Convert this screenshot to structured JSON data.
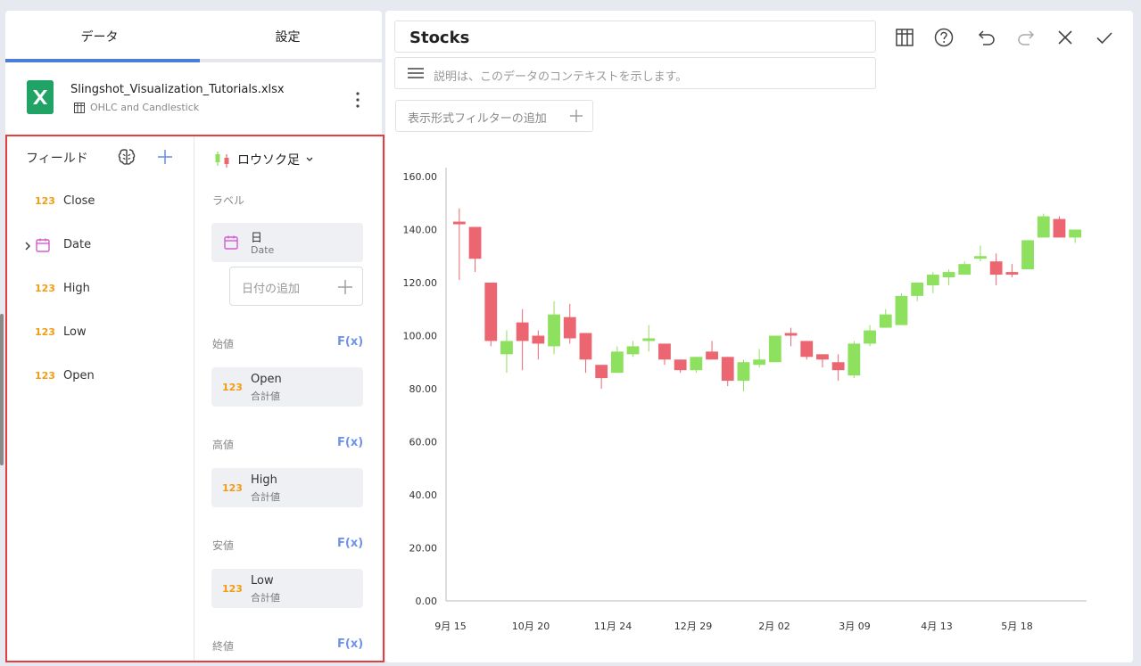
{
  "tabs": [
    {
      "label": "データ"
    },
    {
      "label": "設定"
    }
  ],
  "datasource": {
    "file_name": "Slingshot_Visualization_Tutorials.xlsx",
    "sheet_name": "OHLC and Candlestick"
  },
  "fields_panel": {
    "title": "フィールド",
    "items": [
      {
        "type_label": "123",
        "label": "Close"
      },
      {
        "type_label": "",
        "label": "Date"
      },
      {
        "type_label": "123",
        "label": "High"
      },
      {
        "type_label": "123",
        "label": "Low"
      },
      {
        "type_label": "123",
        "label": "Open"
      }
    ]
  },
  "config": {
    "viz_type": "ロウソク足",
    "label_section": "ラベル",
    "label_pill": {
      "title": "日",
      "sub": "Date"
    },
    "add_date": "日付の追加",
    "open_section": "始値",
    "open_pill": {
      "num": "123",
      "title": "Open",
      "sub": "合計値"
    },
    "high_section": "高値",
    "high_pill": {
      "num": "123",
      "title": "High",
      "sub": "合計値"
    },
    "low_section": "安値",
    "low_pill": {
      "num": "123",
      "title": "Low",
      "sub": "合計値"
    },
    "close_section": "終値",
    "fx": "F(x)"
  },
  "editor": {
    "title": "Stocks",
    "description_placeholder": "説明は、このデータのコンテキストを示します。",
    "filter_button": "表示形式フィルターの追加"
  },
  "colors": {
    "up": "#8ee05f",
    "down": "#eb6670",
    "accent": "#4e7dd9",
    "highlight": "#e53e3e"
  },
  "chart_data": {
    "type": "candlestick",
    "y_tick_labels": [
      "0.00",
      "20.00",
      "40.00",
      "60.00",
      "80.00",
      "100.00",
      "120.00",
      "140.00",
      "160.00"
    ],
    "ylim": [
      0,
      160
    ],
    "x_tick_labels": [
      "9月 15",
      "10月 20",
      "11月 24",
      "12月 29",
      "2月 02",
      "3月 09",
      "4月 13",
      "5月 18"
    ],
    "ohlc": [
      {
        "o": 143,
        "h": 148,
        "l": 121,
        "c": 142
      },
      {
        "o": 141,
        "h": 141,
        "l": 124,
        "c": 129
      },
      {
        "o": 120,
        "h": 120,
        "l": 96,
        "c": 98
      },
      {
        "o": 93,
        "h": 102,
        "l": 86,
        "c": 98
      },
      {
        "o": 105,
        "h": 110,
        "l": 87,
        "c": 98
      },
      {
        "o": 100,
        "h": 102,
        "l": 91,
        "c": 97
      },
      {
        "o": 96,
        "h": 113,
        "l": 93,
        "c": 108
      },
      {
        "o": 107,
        "h": 112,
        "l": 97,
        "c": 99
      },
      {
        "o": 101,
        "h": 101,
        "l": 86,
        "c": 91
      },
      {
        "o": 89,
        "h": 89,
        "l": 80,
        "c": 84
      },
      {
        "o": 86,
        "h": 96,
        "l": 86,
        "c": 94
      },
      {
        "o": 93,
        "h": 98,
        "l": 92,
        "c": 96
      },
      {
        "o": 98,
        "h": 104,
        "l": 94,
        "c": 99
      },
      {
        "o": 97,
        "h": 97,
        "l": 89,
        "c": 91
      },
      {
        "o": 91,
        "h": 91,
        "l": 86,
        "c": 87
      },
      {
        "o": 87,
        "h": 92,
        "l": 86,
        "c": 92
      },
      {
        "o": 94,
        "h": 98,
        "l": 91,
        "c": 91
      },
      {
        "o": 92,
        "h": 92,
        "l": 81,
        "c": 83
      },
      {
        "o": 83,
        "h": 91,
        "l": 79,
        "c": 90
      },
      {
        "o": 89,
        "h": 95,
        "l": 88,
        "c": 91
      },
      {
        "o": 90,
        "h": 100,
        "l": 90,
        "c": 100
      },
      {
        "o": 101,
        "h": 103,
        "l": 96,
        "c": 100
      },
      {
        "o": 98,
        "h": 98,
        "l": 91,
        "c": 92
      },
      {
        "o": 93,
        "h": 93,
        "l": 88,
        "c": 91
      },
      {
        "o": 90,
        "h": 93,
        "l": 83,
        "c": 87
      },
      {
        "o": 85,
        "h": 98,
        "l": 84,
        "c": 97
      },
      {
        "o": 97,
        "h": 104,
        "l": 96,
        "c": 102
      },
      {
        "o": 103,
        "h": 110,
        "l": 103,
        "c": 108
      },
      {
        "o": 104,
        "h": 116,
        "l": 104,
        "c": 115
      },
      {
        "o": 115,
        "h": 120,
        "l": 113,
        "c": 120
      },
      {
        "o": 119,
        "h": 124,
        "l": 116,
        "c": 123
      },
      {
        "o": 122,
        "h": 125,
        "l": 119,
        "c": 124
      },
      {
        "o": 123,
        "h": 128,
        "l": 123,
        "c": 127
      },
      {
        "o": 129,
        "h": 134,
        "l": 128,
        "c": 130
      },
      {
        "o": 128,
        "h": 131,
        "l": 119,
        "c": 123
      },
      {
        "o": 124,
        "h": 127,
        "l": 122,
        "c": 123
      },
      {
        "o": 125,
        "h": 136,
        "l": 125,
        "c": 136
      },
      {
        "o": 137,
        "h": 146,
        "l": 137,
        "c": 145
      },
      {
        "o": 144,
        "h": 145,
        "l": 137,
        "c": 137
      },
      {
        "o": 137,
        "h": 140,
        "l": 135,
        "c": 140
      }
    ]
  }
}
